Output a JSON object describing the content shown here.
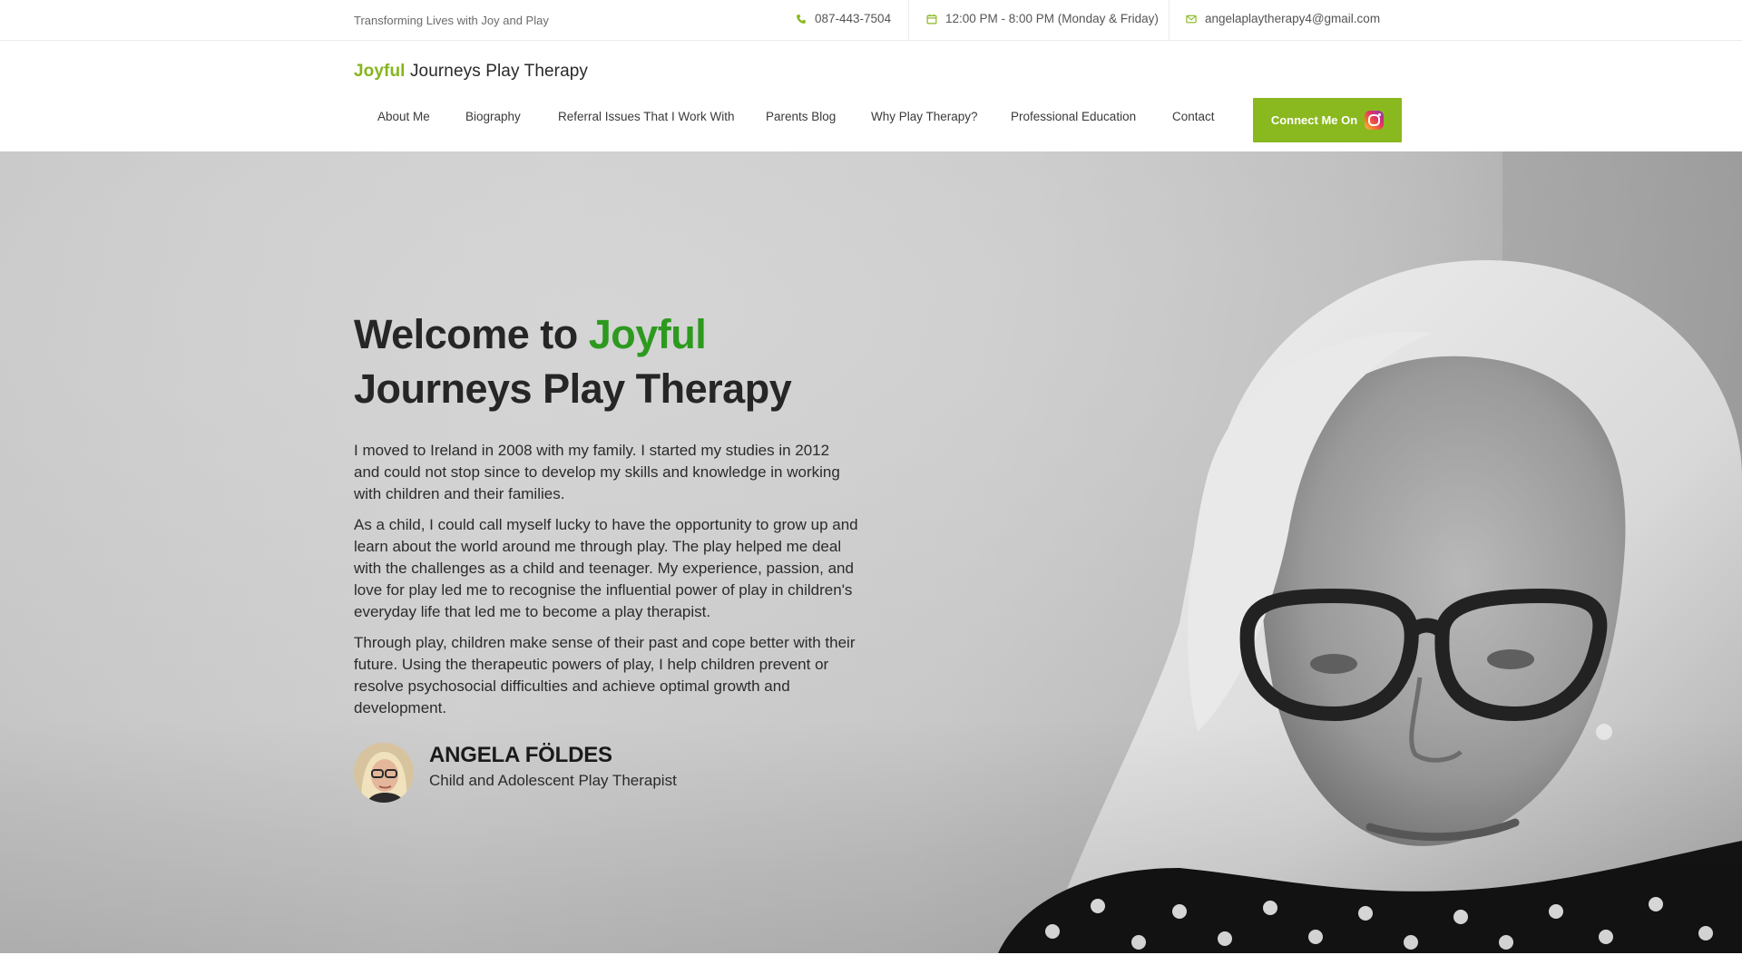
{
  "topbar": {
    "tagline": "Transforming Lives with Joy and Play",
    "phone": "087-443-7504",
    "hours": "12:00 PM - 8:00 PM (Monday & Friday)",
    "email": "angelaplaytherapy4@gmail.com",
    "icons": [
      "phone-icon",
      "calendar-icon",
      "mail-icon"
    ]
  },
  "header": {
    "logo_accent": "Joyful",
    "logo_rest": " Journeys Play Therapy",
    "nav": [
      {
        "label": "About Me"
      },
      {
        "label": "Biography"
      },
      {
        "label": "Referral Issues That I Work With"
      },
      {
        "label": "Parents Blog"
      },
      {
        "label": "Why Play Therapy?"
      },
      {
        "label": "Professional Education"
      },
      {
        "label": "Contact"
      }
    ],
    "cta_label": "Connect Me On"
  },
  "hero": {
    "title_prefix": "Welcome to ",
    "title_accent": "Joyful",
    "title_line2": "Journeys Play Therapy",
    "paragraphs": [
      "I moved to Ireland in 2008 with my family. I started my studies in 2012 and could not stop since to develop my skills and knowledge in working with children and their families.",
      "As a child, I could call myself lucky to have the opportunity to grow up and learn about the world around me through play. The play helped me deal with the challenges as a child and teenager. My experience, passion, and love for play led me to recognise the influential power of play in children's everyday life that led me to become a play therapist.",
      "Through play, children make sense of their past and cope better with their future. Using the therapeutic powers of play, I help children prevent or resolve psychosocial difficulties and achieve optimal growth and development."
    ],
    "profile_name": "ANGELA FÖLDES",
    "profile_role": "Child and Adolescent Play Therapist"
  },
  "colors": {
    "accent_green": "#8ab81f",
    "title_green": "#2d9a1f",
    "logo_green": "#86b51d"
  }
}
